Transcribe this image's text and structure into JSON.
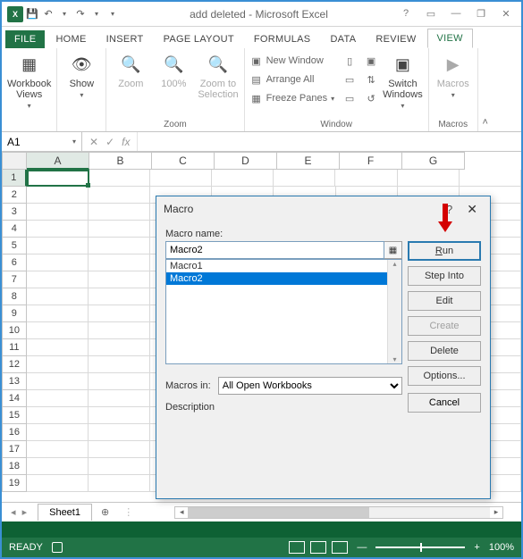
{
  "title": "add deleted - Microsoft Excel",
  "tabs": {
    "file": "FILE",
    "home": "HOME",
    "insert": "INSERT",
    "pagelayout": "PAGE LAYOUT",
    "formulas": "FORMULAS",
    "data": "DATA",
    "review": "REVIEW",
    "view": "VIEW"
  },
  "ribbon": {
    "workbook_views": "Workbook\nViews",
    "show": "Show",
    "zoom": "Zoom",
    "zoom100": "100%",
    "zoom_to_sel": "Zoom to\nSelection",
    "group_zoom": "Zoom",
    "new_window": "New Window",
    "arrange_all": "Arrange All",
    "freeze_panes": "Freeze Panes",
    "switch_windows": "Switch\nWindows",
    "group_window": "Window",
    "macros": "Macros",
    "group_macros": "Macros"
  },
  "namebox": "A1",
  "fx_label": "fx",
  "columns": [
    "A",
    "B",
    "C",
    "D",
    "E",
    "F",
    "G"
  ],
  "rows": [
    "1",
    "2",
    "3",
    "4",
    "5",
    "6",
    "7",
    "8",
    "9",
    "10",
    "11",
    "12",
    "13",
    "14",
    "15",
    "16",
    "17",
    "18",
    "19"
  ],
  "sheet": {
    "name": "Sheet1"
  },
  "status": {
    "ready": "READY",
    "zoom": "100%"
  },
  "dialog": {
    "title": "Macro",
    "macro_name_label": "Macro name:",
    "macro_name_value": "Macro2",
    "list": [
      "Macro1",
      "Macro2"
    ],
    "selected_index": 1,
    "btn_run": "Run",
    "btn_step": "Step Into",
    "btn_edit": "Edit",
    "btn_create": "Create",
    "btn_delete": "Delete",
    "btn_options": "Options...",
    "macros_in_label": "Macros in:",
    "macros_in_value": "All Open Workbooks",
    "description_label": "Description",
    "btn_cancel": "Cancel"
  }
}
